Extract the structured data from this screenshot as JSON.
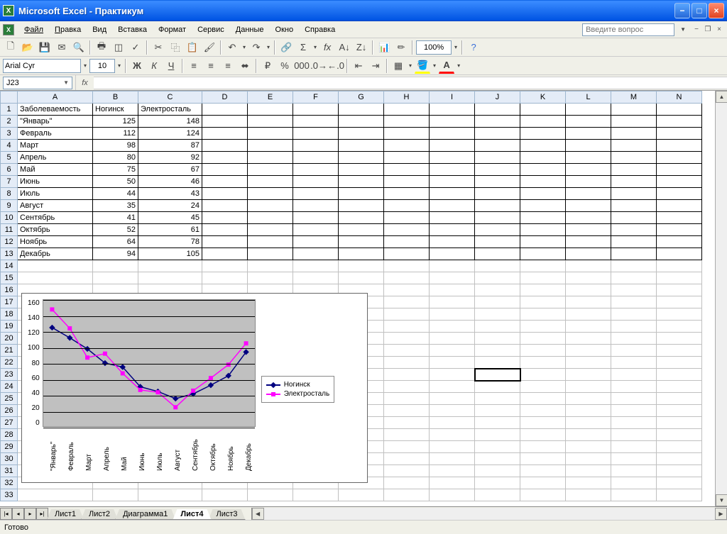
{
  "titlebar": {
    "title": "Microsoft Excel - Практикум"
  },
  "menu": {
    "file": "Файл",
    "edit": "Правка",
    "view": "Вид",
    "insert": "Вставка",
    "format": "Формат",
    "tools": "Сервис",
    "data": "Данные",
    "window": "Окно",
    "help": "Справка"
  },
  "help_placeholder": "Введите вопрос",
  "font": {
    "name": "Arial Cyr",
    "size": "10"
  },
  "zoom": "100%",
  "namebox": "J23",
  "columns": [
    "A",
    "B",
    "C",
    "D",
    "E",
    "F",
    "G",
    "H",
    "I",
    "J",
    "K",
    "L",
    "M",
    "N"
  ],
  "headers": {
    "a": "Заболеваемость",
    "b": "Ногинск",
    "c": "Электросталь"
  },
  "rows": [
    {
      "m": "\"Январь\"",
      "b": 125,
      "c": 148
    },
    {
      "m": "Февраль",
      "b": 112,
      "c": 124
    },
    {
      "m": "Март",
      "b": 98,
      "c": 87
    },
    {
      "m": "Апрель",
      "b": 80,
      "c": 92
    },
    {
      "m": "Май",
      "b": 75,
      "c": 67
    },
    {
      "m": "Июнь",
      "b": 50,
      "c": 46
    },
    {
      "m": "Июль",
      "b": 44,
      "c": 43
    },
    {
      "m": "Август",
      "b": 35,
      "c": 24
    },
    {
      "m": "Сентябрь",
      "b": 41,
      "c": 45
    },
    {
      "m": "Октябрь",
      "b": 52,
      "c": 61
    },
    {
      "m": "Ноябрь",
      "b": 64,
      "c": 78
    },
    {
      "m": "Декабрь",
      "b": 94,
      "c": 105
    }
  ],
  "blank_rows": 20,
  "selected_cell": "J23",
  "sheets": {
    "tabs": [
      "Лист1",
      "Лист2",
      "Диаграмма1",
      "Лист4",
      "Лист3"
    ],
    "active": "Лист4"
  },
  "status": "Готово",
  "chart_data": {
    "type": "line",
    "categories": [
      "\"Январь\"",
      "Февраль",
      "Март",
      "Апрель",
      "Май",
      "Июнь",
      "Июль",
      "Август",
      "Сентябрь",
      "Октябрь",
      "Ноябрь",
      "Декабрь"
    ],
    "series": [
      {
        "name": "Ногинск",
        "color": "#000080",
        "values": [
          125,
          112,
          98,
          80,
          75,
          50,
          44,
          35,
          41,
          52,
          64,
          94
        ]
      },
      {
        "name": "Электросталь",
        "color": "#ff00ff",
        "values": [
          148,
          124,
          87,
          92,
          67,
          46,
          43,
          24,
          45,
          61,
          78,
          105
        ]
      }
    ],
    "ylim": [
      0,
      160
    ],
    "yticks": [
      0,
      20,
      40,
      60,
      80,
      100,
      120,
      140,
      160
    ]
  }
}
